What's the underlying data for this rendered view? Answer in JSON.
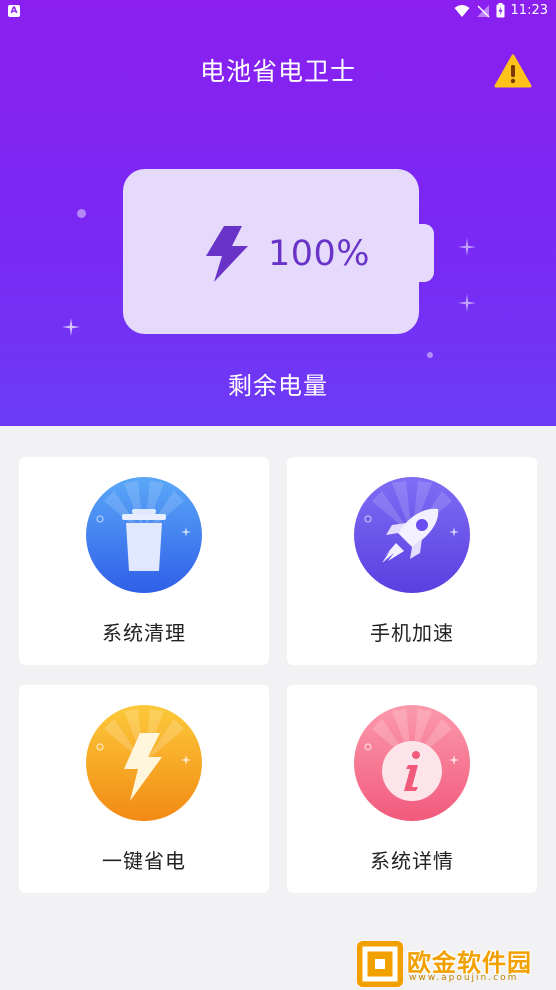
{
  "status_bar": {
    "left_badge": "A",
    "time": "11:23"
  },
  "header": {
    "title": "电池省电卫士",
    "alert_icon": "warning-icon"
  },
  "battery": {
    "level_text": "100%",
    "level_fraction": 1.0,
    "caption": "剩余电量",
    "fill_color": "#e6dafc",
    "text_color": "#6a33c8"
  },
  "features": [
    {
      "label": "系统清理",
      "icon": "trash-icon",
      "color": "#3b74f0"
    },
    {
      "label": "手机加速",
      "icon": "rocket-icon",
      "color": "#6a4cf0"
    },
    {
      "label": "一键省电",
      "icon": "lightning-icon",
      "color": "#f5a020"
    },
    {
      "label": "系统详情",
      "icon": "info-icon",
      "color": "#f56a8a"
    }
  ],
  "watermark": {
    "text": "欧金软件园",
    "url": "www.apoujin.com"
  },
  "colors": {
    "hero_top": "#8a1ff0",
    "hero_bottom": "#6c3bf7",
    "page_bg": "#f2f2f4"
  }
}
